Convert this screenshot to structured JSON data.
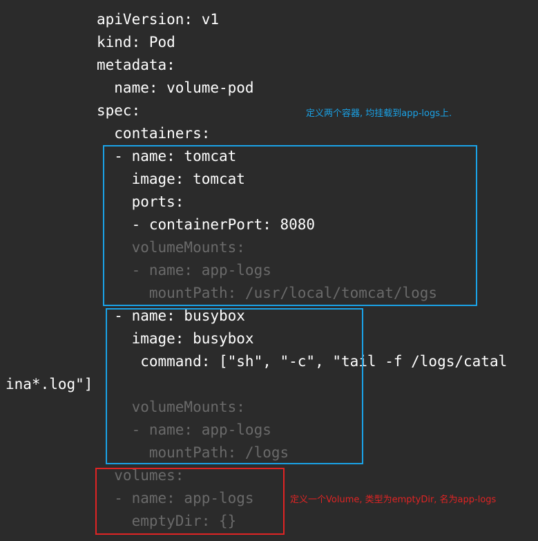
{
  "yaml_lines": [
    "apiVersion: v1",
    "kind: Pod",
    "metadata:",
    "  name: volume-pod",
    "spec:",
    "  containers:",
    "  - name: tomcat",
    "    image: tomcat",
    "    ports:",
    "    - containerPort: 8080",
    "    volumeMounts:",
    "    - name: app-logs",
    "      mountPath: /usr/local/tomcat/logs",
    "  - name: busybox",
    "    image: busybox",
    "     command: [\"sh\", \"-c\", \"tail -f /logs/catal",
    "ina*.log\"]",
    "    volumeMounts:",
    "    - name: app-logs",
    "      mountPath: /logs",
    "  volumes:",
    "  - name: app-logs",
    "    emptyDir: {}"
  ],
  "annotations": {
    "containers_note": "定义两个容器, 均挂载到app-logs上.",
    "volume_note": "定义一个Volume, 类型为emptyDir, 名为app-logs"
  },
  "colors": {
    "background": "#2b2b2b",
    "text": "#ffffff",
    "dim_text": "#6a6a6a",
    "blue_annotation": "#1aa3e8",
    "red_annotation": "#e02424"
  }
}
